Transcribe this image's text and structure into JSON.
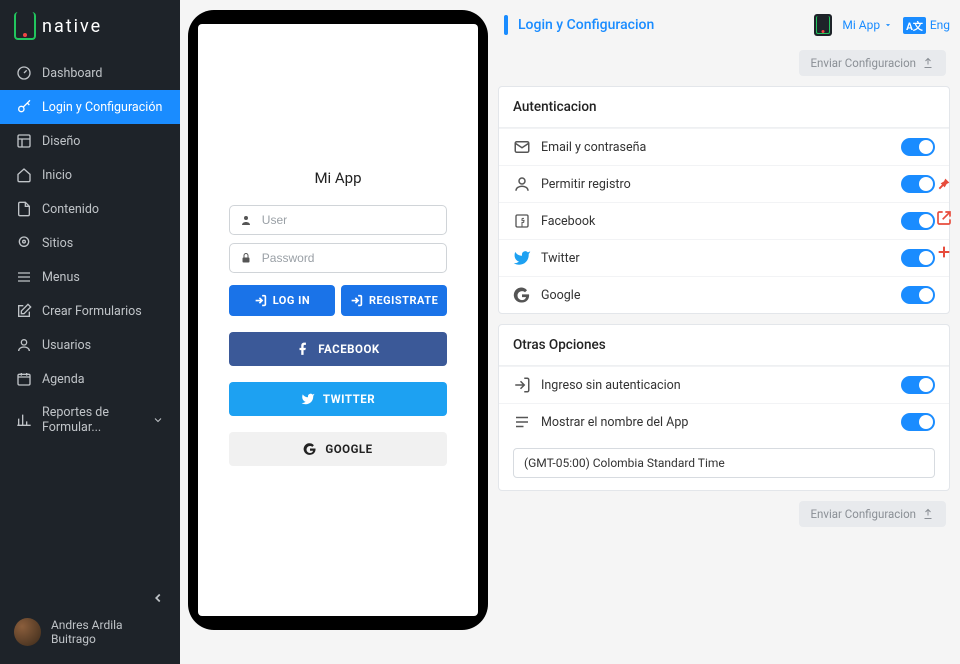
{
  "brand": "native",
  "sidebar": {
    "items": [
      {
        "label": "Dashboard"
      },
      {
        "label": "Login y Configuración"
      },
      {
        "label": "Diseño"
      },
      {
        "label": "Inicio"
      },
      {
        "label": "Contenido"
      },
      {
        "label": "Sitios"
      },
      {
        "label": "Menus"
      },
      {
        "label": "Crear Formularios"
      },
      {
        "label": "Usuarios"
      },
      {
        "label": "Agenda"
      },
      {
        "label": "Reportes de Formular..."
      }
    ],
    "active_index": 1,
    "user": "Andres Ardila Buitrago"
  },
  "preview": {
    "app_title": "Mi App",
    "user_placeholder": "User",
    "password_placeholder": "Password",
    "login_label": "LOG IN",
    "register_label": "REGISTRATE",
    "facebook_label": "FACEBOOK",
    "twitter_label": "TWITTER",
    "google_label": "GOOGLE"
  },
  "config": {
    "title": "Login y Configuracion",
    "app_selector": "Mi App",
    "lang_label": "Eng",
    "send_label": "Enviar Configuracion",
    "auth": {
      "title": "Autenticacion",
      "options": [
        {
          "label": "Email y contraseña",
          "on": true
        },
        {
          "label": "Permitir registro",
          "on": true
        },
        {
          "label": "Facebook",
          "on": true
        },
        {
          "label": "Twitter",
          "on": true
        },
        {
          "label": "Google",
          "on": true
        }
      ]
    },
    "other": {
      "title": "Otras Opciones",
      "options": [
        {
          "label": "Ingreso sin autenticacion",
          "on": true
        },
        {
          "label": "Mostrar el nombre del App",
          "on": true
        }
      ],
      "timezone": "(GMT-05:00) Colombia Standard Time"
    }
  }
}
